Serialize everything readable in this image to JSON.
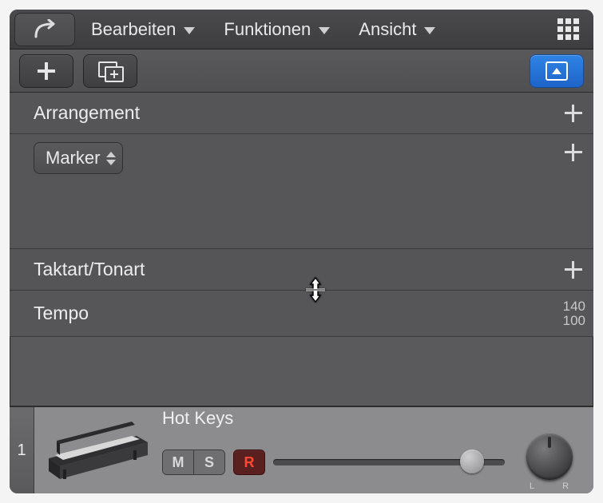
{
  "menubar": {
    "edit": "Bearbeiten",
    "functions": "Funktionen",
    "view": "Ansicht"
  },
  "global_tracks": {
    "arrangement": "Arrangement",
    "marker": "Marker",
    "signature": "Taktart/Tonart",
    "tempo": "Tempo",
    "tempo_hi": "140",
    "tempo_lo": "100"
  },
  "track": {
    "index": "1",
    "name": "Hot Keys",
    "mute": "M",
    "solo": "S",
    "rec": "R",
    "pan_l": "L",
    "pan_r": "R"
  }
}
